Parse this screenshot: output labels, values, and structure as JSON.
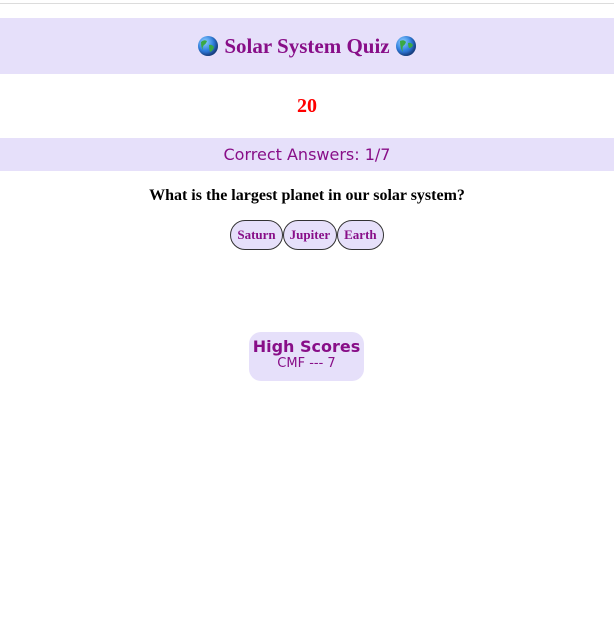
{
  "header": {
    "title": "Solar System Quiz",
    "left_icon": "globe-icon",
    "right_icon": "globe-icon"
  },
  "timer": {
    "value": "20"
  },
  "score": {
    "text": "Correct Answers: 1/7"
  },
  "question": {
    "text": "What is the largest planet in our solar system?"
  },
  "answers": [
    {
      "label": "Saturn"
    },
    {
      "label": "Jupiter"
    },
    {
      "label": "Earth"
    }
  ],
  "high_scores": {
    "title": "High Scores",
    "entries": [
      {
        "text": "CMF --- 7"
      }
    ]
  },
  "colors": {
    "accent": "#880e88",
    "band_background": "#e6e0fa",
    "timer": "#ff0000"
  }
}
